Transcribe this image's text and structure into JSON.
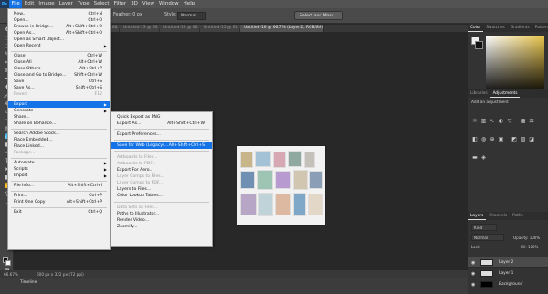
{
  "app": {
    "logo": "Ps"
  },
  "menubar": [
    "File",
    "Edit",
    "Image",
    "Layer",
    "Type",
    "Select",
    "Filter",
    "3D",
    "View",
    "Window",
    "Help"
  ],
  "options": {
    "feather": "Feather: 0 px",
    "style_label": "Style:",
    "style_value": "Normal",
    "select_mask": "Select and Mask..."
  },
  "tabs": [
    "Untitled-10 @ 66.7%",
    "Untitled-11 @ 66.7%",
    "Untitled-12 @ 66.7%",
    "Untitled-13 @ 66.7%",
    "Untitled-14 @ 66.7%",
    "Untitled-15 @ 66.7%",
    "Untitled-16 @ 66.7% (Layer 2, RGB/8#)"
  ],
  "file_menu": [
    {
      "label": "New...",
      "shortcut": "Ctrl+N"
    },
    {
      "label": "Open...",
      "shortcut": "Ctrl+O"
    },
    {
      "label": "Browse in Bridge...",
      "shortcut": "Alt+Shift+Ctrl+O"
    },
    {
      "label": "Open As...",
      "shortcut": "Alt+Shift+Ctrl+O"
    },
    {
      "label": "Open as Smart Object...",
      "shortcut": ""
    },
    {
      "label": "Open Recent",
      "shortcut": "",
      "submenu": true
    },
    {
      "label": "Close",
      "shortcut": "Ctrl+W"
    },
    {
      "label": "Close All",
      "shortcut": "Alt+Ctrl+W"
    },
    {
      "label": "Close Others",
      "shortcut": "Alt+Ctrl+P"
    },
    {
      "label": "Close and Go to Bridge...",
      "shortcut": "Shift+Ctrl+W"
    },
    {
      "label": "Save",
      "shortcut": "Ctrl+S"
    },
    {
      "label": "Save As...",
      "shortcut": "Shift+Ctrl+S"
    },
    {
      "label": "Revert",
      "shortcut": "F12",
      "disabled": true
    },
    {
      "label": "Export",
      "shortcut": "",
      "submenu": true,
      "highlight": true
    },
    {
      "label": "Generate",
      "shortcut": "",
      "submenu": true
    },
    {
      "label": "Share...",
      "shortcut": ""
    },
    {
      "label": "Share on Behance...",
      "shortcut": ""
    },
    {
      "label": "Search Adobe Stock...",
      "shortcut": ""
    },
    {
      "label": "Place Embedded...",
      "shortcut": ""
    },
    {
      "label": "Place Linked...",
      "shortcut": ""
    },
    {
      "label": "Package...",
      "shortcut": "",
      "disabled": true
    },
    {
      "label": "Automate",
      "shortcut": "",
      "submenu": true
    },
    {
      "label": "Scripts",
      "shortcut": "",
      "submenu": true
    },
    {
      "label": "Import",
      "shortcut": "",
      "submenu": true
    },
    {
      "label": "File Info...",
      "shortcut": "Alt+Shift+Ctrl+I"
    },
    {
      "label": "Print...",
      "shortcut": "Ctrl+P"
    },
    {
      "label": "Print One Copy",
      "shortcut": "Alt+Shift+Ctrl+P"
    },
    {
      "label": "Exit",
      "shortcut": "Ctrl+Q"
    }
  ],
  "export_menu": [
    {
      "label": "Quick Export as PNG",
      "shortcut": ""
    },
    {
      "label": "Export As...",
      "shortcut": "Alt+Shift+Ctrl+W"
    },
    {
      "label": "Export Preferences...",
      "shortcut": ""
    },
    {
      "label": "Save for Web (Legacy)...",
      "shortcut": "Alt+Shift+Ctrl+S",
      "highlight": true
    },
    {
      "label": "Artboards to Files...",
      "shortcut": "",
      "disabled": true
    },
    {
      "label": "Artboards to PDF...",
      "shortcut": "",
      "disabled": true
    },
    {
      "label": "Export For Aero...",
      "shortcut": ""
    },
    {
      "label": "Layer Comps to Files...",
      "shortcut": "",
      "disabled": true
    },
    {
      "label": "Layer Comps to PDF...",
      "shortcut": "",
      "disabled": true
    },
    {
      "label": "Layers to Files...",
      "shortcut": ""
    },
    {
      "label": "Color Lookup Tables...",
      "shortcut": ""
    },
    {
      "label": "Data Sets as Files...",
      "shortcut": "",
      "disabled": true
    },
    {
      "label": "Paths to Illustrator...",
      "shortcut": ""
    },
    {
      "label": "Render Video...",
      "shortcut": ""
    },
    {
      "label": "Zoomify...",
      "shortcut": ""
    }
  ],
  "color_panel": {
    "tabs": [
      "Color",
      "Swatches",
      "Gradients",
      "Patterns"
    ]
  },
  "adjust_panel": {
    "tabs": [
      "Libraries",
      "Adjustments"
    ],
    "label": "Add an adjustment"
  },
  "layers_panel": {
    "tabs": [
      "Layers",
      "Channels",
      "Paths"
    ],
    "kind": "Kind",
    "blend": "Normal",
    "opacity": "Opacity: 100%",
    "lock": "Lock:",
    "fill": "Fill: 100%",
    "layers": [
      {
        "name": "Layer 2",
        "selected": true
      },
      {
        "name": "Layer 1"
      },
      {
        "name": "Background",
        "italic": true
      }
    ]
  },
  "status": {
    "zoom": "66.67%",
    "size": "600 px x 322 px (72 ppi)"
  },
  "timeline": {
    "title": "Timeline"
  }
}
